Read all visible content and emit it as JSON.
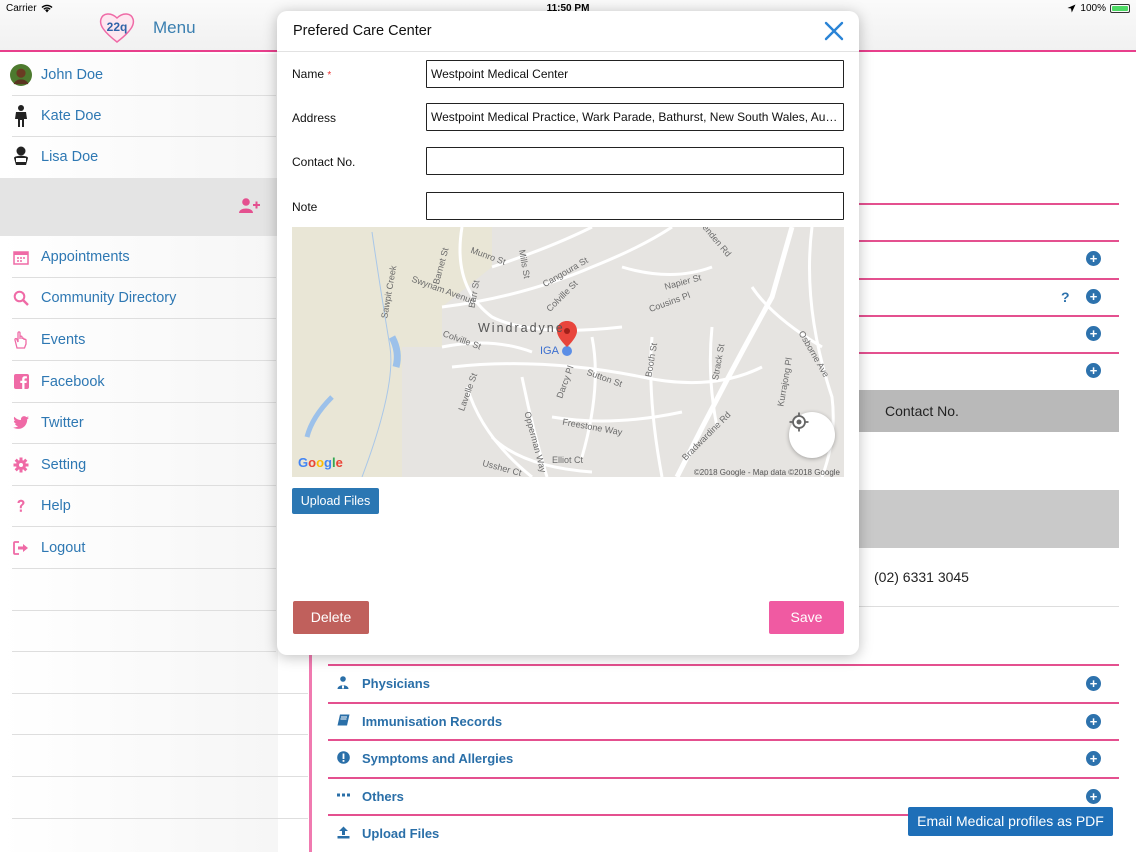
{
  "status_bar": {
    "carrier": "Carrier",
    "time": "11:50 PM",
    "battery": "100%"
  },
  "header": {
    "menu_title": "Menu",
    "logo_text": "22q"
  },
  "sidebar": {
    "profiles": [
      {
        "label": "John Doe",
        "icon": "avatar-photo"
      },
      {
        "label": "Kate Doe",
        "icon": "child-icon"
      },
      {
        "label": "Lisa Doe",
        "icon": "baby-icon"
      }
    ],
    "menu": [
      {
        "label": "Appointments",
        "icon": "calendar-icon"
      },
      {
        "label": "Community Directory",
        "icon": "search-icon"
      },
      {
        "label": "Events",
        "icon": "hand-icon"
      },
      {
        "label": "Facebook",
        "icon": "facebook-icon"
      },
      {
        "label": "Twitter",
        "icon": "twitter-icon"
      },
      {
        "label": "Setting",
        "icon": "gear-icon"
      },
      {
        "label": "Help",
        "icon": "question-icon"
      },
      {
        "label": "Logout",
        "icon": "logout-icon"
      }
    ]
  },
  "main": {
    "contact_header": "Contact No.",
    "contact_value": "(02) 6331 3045",
    "sections": [
      {
        "label": "Physicians",
        "icon": "doctor-icon"
      },
      {
        "label": "Immunisation Records",
        "icon": "book-icon"
      },
      {
        "label": "Symptoms and Allergies",
        "icon": "alert-icon"
      },
      {
        "label": "Others",
        "icon": "ellipsis-icon"
      },
      {
        "label": "Upload Files",
        "icon": "upload-icon"
      }
    ],
    "email_button": "Email Medical profiles as PDF"
  },
  "modal": {
    "title": "Prefered Care Center",
    "fields": {
      "name_label": "Name",
      "name_required": "*",
      "name_value": "Westpoint Medical Center",
      "address_label": "Address",
      "address_value": "Westpoint Medical Practice, Wark Parade, Bathurst, New South Wales, Australia",
      "contact_label": "Contact No.",
      "contact_value": "",
      "note_label": "Note",
      "note_value": ""
    },
    "map": {
      "area_label": "Windradyne",
      "place_label": "IGA",
      "copyright": "©2018 Google - Map data ©2018 Google",
      "streets": [
        "Munro St",
        "Mills St",
        "Cangoura St",
        "Colville St",
        "Barnet St",
        "Swynam Avenue",
        "Barr St",
        "Colville St",
        "Sawpit Creek",
        "Lavelle St",
        "Sutton St",
        "Darcy Pl",
        "Freestone Way",
        "Opperman Way",
        "Elliot Ct",
        "Ussher Ct",
        "Booth St",
        "Strack St",
        "Bradwardine Rd",
        "Osborne Ave",
        "Kurrajong Pl",
        "Napier St",
        "Cousins Pl",
        "Denden Rd"
      ]
    },
    "upload_button": "Upload Files",
    "delete_button": "Delete",
    "save_button": "Save"
  },
  "colors": {
    "accent_pink": "#e4508f",
    "link_blue": "#2e78b3",
    "save": "#f05aa2",
    "delete": "#c0605c",
    "email": "#1e6fb8"
  }
}
